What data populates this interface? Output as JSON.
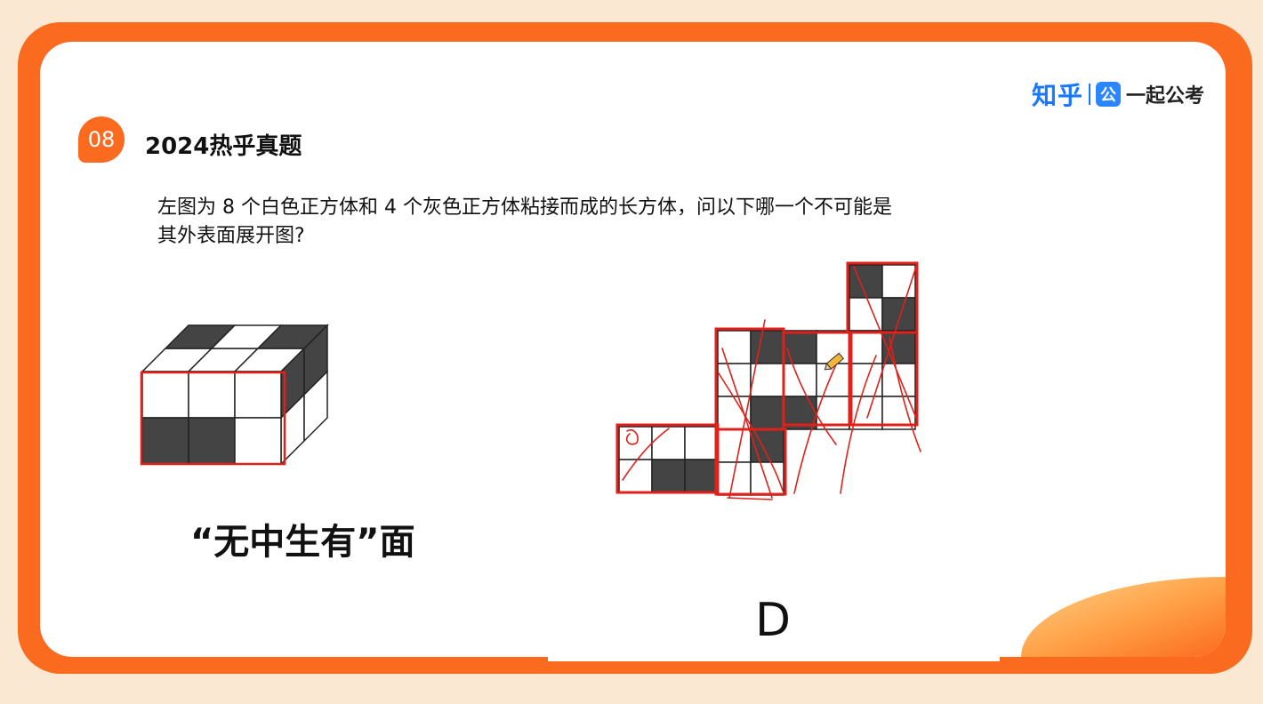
{
  "logo": {
    "zhihu": "知乎",
    "badge": "公",
    "brand": "一起公考"
  },
  "question": {
    "number": "08",
    "title": "2024热乎真题",
    "text_line1": "左图为 8 个白色正方体和 4 个灰色正方体粘接而成的长方体，问以下哪一个不可能是",
    "text_line2": "其外表面展开图?"
  },
  "caption": "“无中生有”面",
  "answer_label": "D",
  "colors": {
    "accent": "#fb6b1f",
    "brand_blue": "#1677ff",
    "dark_cell": "#444444",
    "annotation_red": "#e0201a"
  },
  "icons": [
    "pencil-cursor-icon"
  ]
}
